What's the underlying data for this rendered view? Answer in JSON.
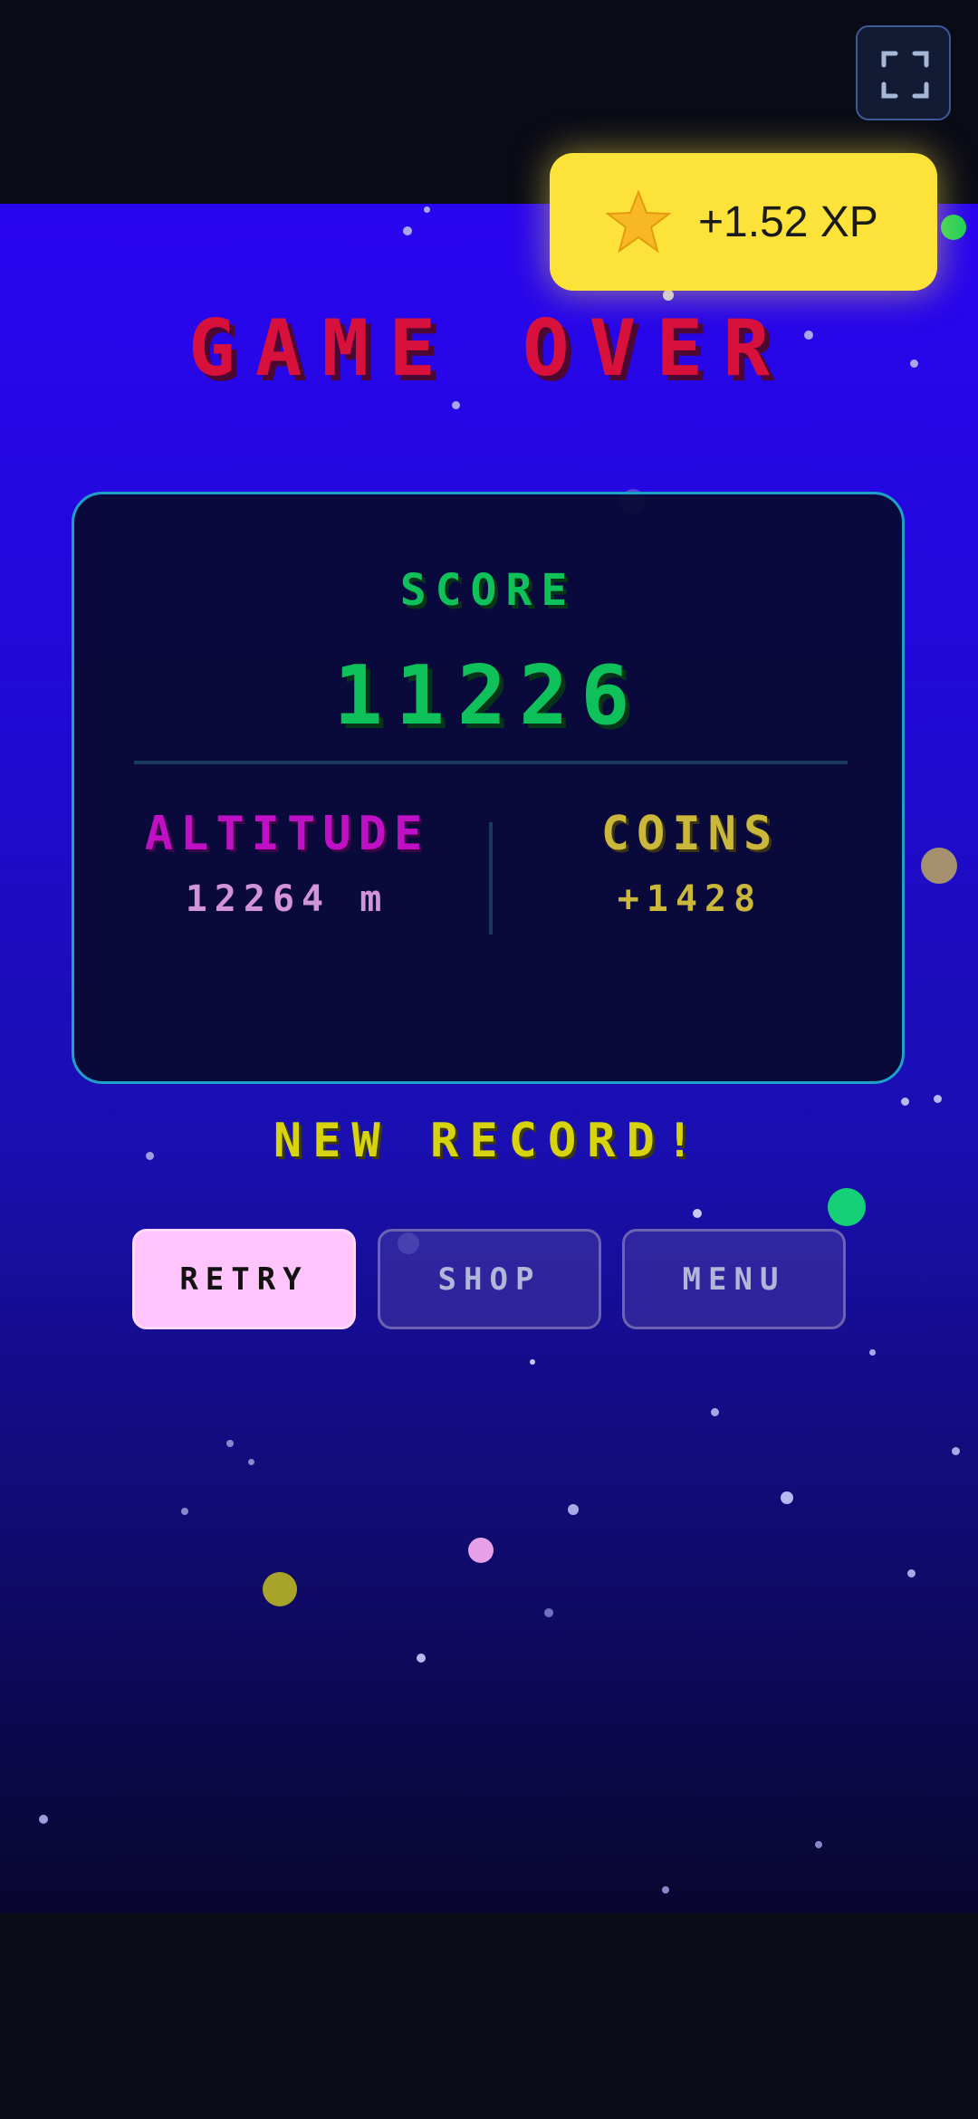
{
  "header": {
    "fullscreen_icon": "fullscreen-icon"
  },
  "xp_toast": {
    "icon": "star-icon",
    "text": "+1.52 XP"
  },
  "game_over": {
    "title": "GAME OVER",
    "score_label": "SCORE",
    "score_value": "11226",
    "altitude_label": "ALTITUDE",
    "altitude_value": "12264 m",
    "coins_label": "COINS",
    "coins_value": "+1428",
    "new_record": "NEW RECORD!"
  },
  "buttons": {
    "retry": "RETRY",
    "shop": "SHOP",
    "menu": "MENU"
  },
  "colors": {
    "title": "#d8103c",
    "score": "#0ec15a",
    "altitude": "#c010c6",
    "coins": "#cbb83a",
    "record": "#d7d30f",
    "toast": "#fde23a",
    "retry_bg": "#ffc4fb"
  }
}
